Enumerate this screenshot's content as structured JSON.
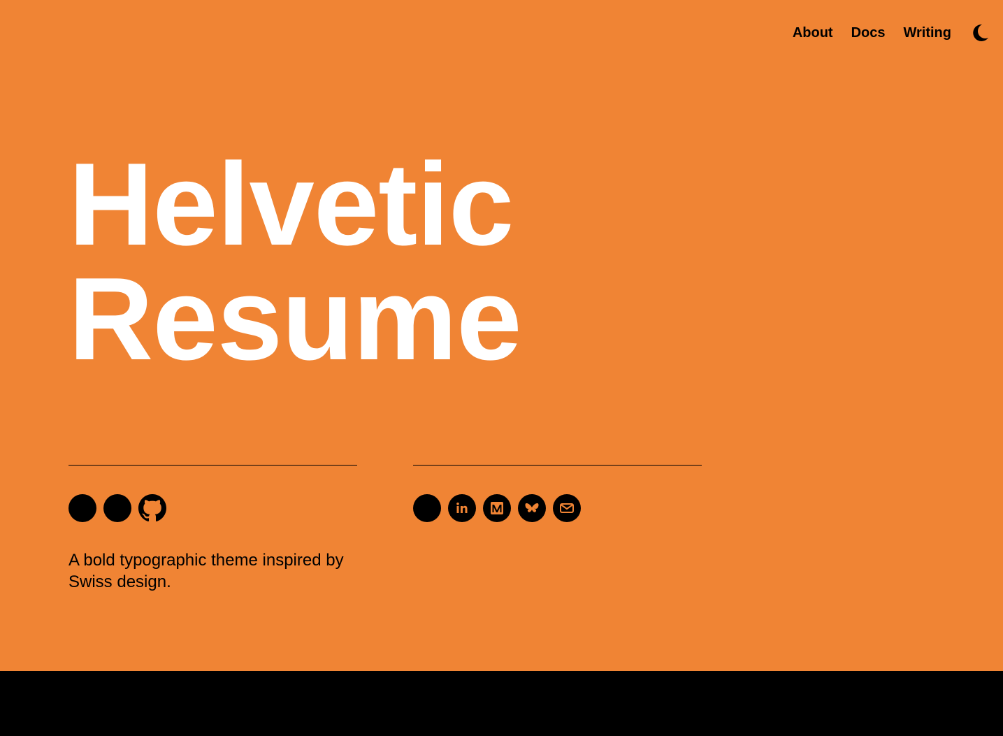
{
  "nav": {
    "items": [
      {
        "label": "About"
      },
      {
        "label": "Docs"
      },
      {
        "label": "Writing"
      }
    ],
    "theme_toggle_icon": "moon-icon"
  },
  "hero": {
    "title_line1": "Helvetic",
    "title_line2": "Resume",
    "tagline": "A bold typographic theme inspired by Swiss design."
  },
  "left_icons": [
    "circle-icon",
    "circle-icon",
    "github-icon"
  ],
  "right_icons": [
    "circle-icon",
    "linkedin-icon",
    "medium-icon",
    "bluesky-icon",
    "mail-icon"
  ],
  "colors": {
    "background": "#F08434",
    "title": "#FFFFFF",
    "text": "#000000",
    "footer": "#000000"
  }
}
